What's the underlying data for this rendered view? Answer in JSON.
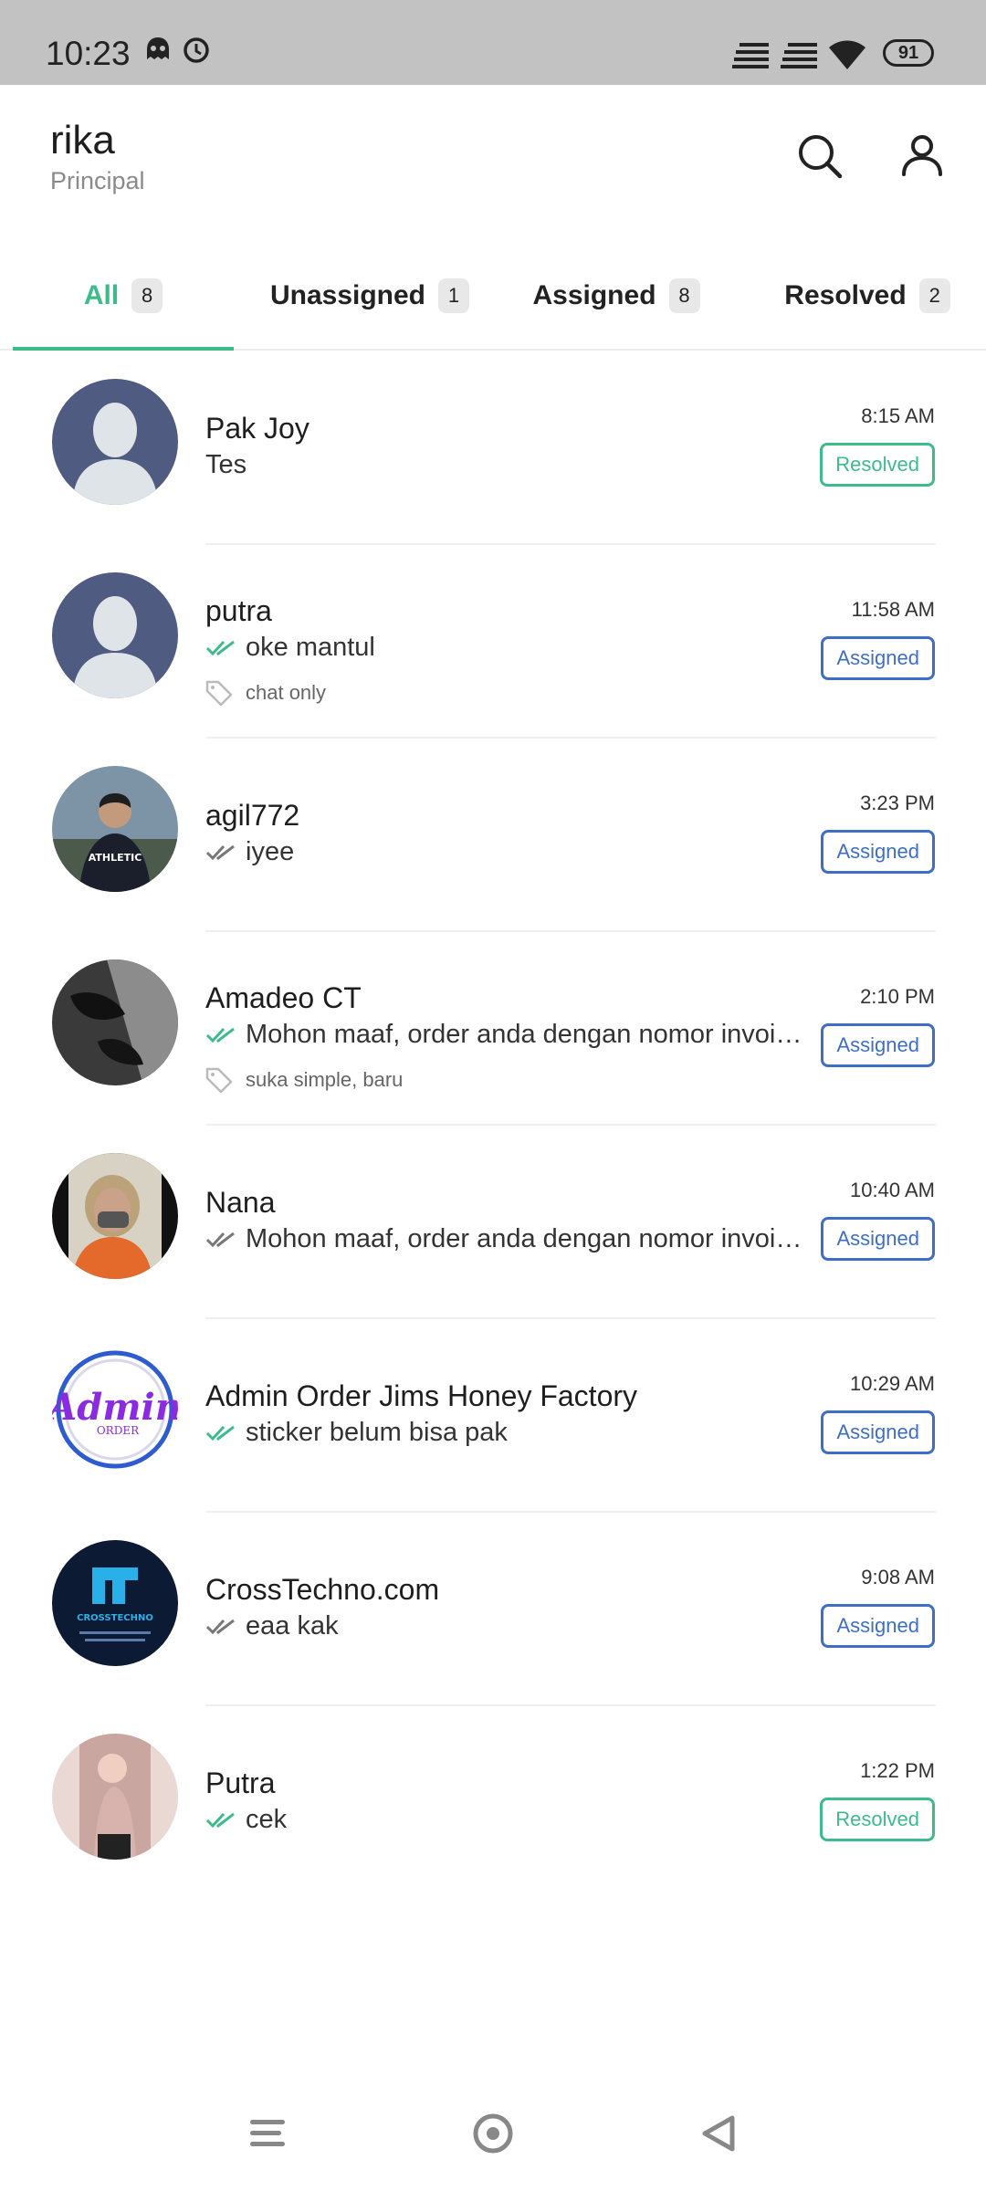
{
  "status_bar": {
    "time": "10:23",
    "battery": "91",
    "icons": [
      "ghost-icon",
      "alarm-icon",
      "signal-icon",
      "signal-icon",
      "wifi-icon",
      "battery-icon"
    ]
  },
  "header": {
    "user_name": "rika",
    "user_role": "Principal",
    "icons": [
      "search-icon",
      "profile-icon"
    ]
  },
  "tabs": [
    {
      "label": "All",
      "count": "8",
      "active": true
    },
    {
      "label": "Unassigned",
      "count": "1",
      "active": false
    },
    {
      "label": "Assigned",
      "count": "8",
      "active": false
    },
    {
      "label": "Resolved",
      "count": "2",
      "active": false
    }
  ],
  "colors": {
    "accent": "#3dbb8a",
    "assigned": "#3e6fc4",
    "resolved": "#3dbb8a",
    "status_bar": "#c2c2c2"
  },
  "conversations": [
    {
      "name": "Pak Joy",
      "message": "Tes",
      "time": "8:15 AM",
      "status": "Resolved",
      "tick": "none",
      "tag": "",
      "avatar": "default-avatar"
    },
    {
      "name": "putra",
      "message": "oke mantul",
      "time": "11:58 AM",
      "status": "Assigned",
      "tick": "read",
      "tag": "chat only",
      "avatar": "default-avatar"
    },
    {
      "name": "agil772",
      "message": "iyee",
      "time": "3:23 PM",
      "status": "Assigned",
      "tick": "delivered",
      "tag": "",
      "avatar": "photo-avatar"
    },
    {
      "name": "Amadeo CT",
      "message": "Mohon maaf, order anda dengan nomor invoice",
      "time": "2:10 PM",
      "status": "Assigned",
      "tick": "read",
      "tag": "suka simple, baru",
      "avatar": "photo-avatar"
    },
    {
      "name": "Nana",
      "message": "Mohon maaf, order anda dengan nomor invoice",
      "time": "10:40 AM",
      "status": "Assigned",
      "tick": "delivered",
      "tag": "",
      "avatar": "photo-avatar"
    },
    {
      "name": "Admin Order Jims Honey Factory",
      "message": "sticker belum bisa pak",
      "time": "10:29 AM",
      "status": "Assigned",
      "tick": "read",
      "tag": "",
      "avatar": "admin-logo"
    },
    {
      "name": "CrossTechno.com",
      "message": "eaa kak",
      "time": "9:08 AM",
      "status": "Assigned",
      "tick": "delivered",
      "tag": "",
      "avatar": "crosstechno-logo"
    },
    {
      "name": "Putra",
      "message": "cek",
      "time": "1:22 PM",
      "status": "Resolved",
      "tick": "read",
      "tag": "",
      "avatar": "photo-avatar"
    }
  ],
  "nav_bar": {
    "icons": [
      "menu-icon",
      "home-icon",
      "back-icon"
    ]
  }
}
